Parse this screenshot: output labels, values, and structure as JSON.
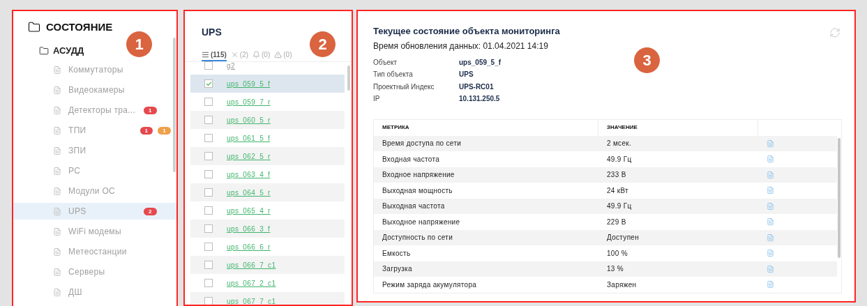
{
  "annotations": [
    {
      "label": "1"
    },
    {
      "label": "2"
    },
    {
      "label": "3"
    }
  ],
  "sidebar": {
    "tree": [
      {
        "label": "СОСТОЯНИЕ",
        "children": [
          {
            "label": "АСУДД",
            "children": [
              {
                "label": "Коммутаторы",
                "selected": false
              },
              {
                "label": "Видеокамеры",
                "selected": false
              },
              {
                "label": "Детекторы тра...",
                "selected": false,
                "badges": [
                  {
                    "text": "1",
                    "color": "#e5484d"
                  }
                ]
              },
              {
                "label": "ТПИ",
                "selected": false,
                "badges": [
                  {
                    "text": "1",
                    "color": "#e5484d"
                  },
                  {
                    "text": "1",
                    "color": "#f0a04b"
                  }
                ]
              },
              {
                "label": "ЗПИ",
                "selected": false
              },
              {
                "label": "РС",
                "selected": false
              },
              {
                "label": "Модули ОС",
                "selected": false
              },
              {
                "label": "UPS",
                "selected": true,
                "badges": [
                  {
                    "text": "2",
                    "color": "#e5484d"
                  }
                ]
              },
              {
                "label": "WiFi модемы",
                "selected": false
              },
              {
                "label": "Метеостанции",
                "selected": false
              },
              {
                "label": "Серверы",
                "selected": false
              },
              {
                "label": "ДШ",
                "selected": false
              }
            ]
          }
        ]
      }
    ]
  },
  "object_list": {
    "title": "UPS",
    "tabs": [
      {
        "kind": "all",
        "label": "(115)",
        "selected": true
      },
      {
        "kind": "error",
        "label": "(2)",
        "selected": false
      },
      {
        "kind": "alarm",
        "label": "(0)",
        "selected": false
      },
      {
        "kind": "warning",
        "label": "(0)",
        "selected": false
      }
    ],
    "rows": [
      {
        "kind": "group",
        "label": "g2",
        "checked": false,
        "selected": false
      },
      {
        "kind": "object",
        "label": "ups_059_5_f",
        "checked": true,
        "selected": true
      },
      {
        "kind": "object",
        "label": "ups_059_7_r",
        "checked": false,
        "selected": false
      },
      {
        "kind": "object",
        "label": "ups_060_5_r",
        "checked": false,
        "selected": false
      },
      {
        "kind": "object",
        "label": "ups_061_5_f",
        "checked": false,
        "selected": false
      },
      {
        "kind": "object",
        "label": "ups_062_5_r",
        "checked": false,
        "selected": false
      },
      {
        "kind": "object",
        "label": "ups_063_4_f",
        "checked": false,
        "selected": false
      },
      {
        "kind": "object",
        "label": "ups_064_5_r",
        "checked": false,
        "selected": false
      },
      {
        "kind": "object",
        "label": "ups_065_4_r",
        "checked": false,
        "selected": false
      },
      {
        "kind": "object",
        "label": "ups_066_3_f",
        "checked": false,
        "selected": false
      },
      {
        "kind": "object",
        "label": "ups_066_6_r",
        "checked": false,
        "selected": false
      },
      {
        "kind": "object",
        "label": "ups_066_7_c1",
        "checked": false,
        "selected": false
      },
      {
        "kind": "object",
        "label": "ups_067_2_c1",
        "checked": false,
        "selected": false
      },
      {
        "kind": "object",
        "label": "ups_067_7_c1",
        "checked": false,
        "selected": false
      }
    ]
  },
  "details": {
    "title": "Текущее состояние объекта мониторинга",
    "updated": "Время обновления данных: 01.04.2021 14:19",
    "fields": [
      {
        "label": "Объект",
        "value": "ups_059_5_f"
      },
      {
        "label": "Тип объекта",
        "value": "UPS"
      },
      {
        "label": "Проектный Индекс",
        "value": "UPS-RC01"
      },
      {
        "label": "IP",
        "value": "10.131.250.5"
      }
    ],
    "table": {
      "columns": [
        "МЕТРИКА",
        "ЗНАЧЕНИЕ"
      ],
      "rows": [
        [
          "Время доступа по сети",
          "2 мсек."
        ],
        [
          "Входная частота",
          "49.9 Гц"
        ],
        [
          "Входное напряжение",
          "233 В"
        ],
        [
          "Выходная мощность",
          "24 кВт"
        ],
        [
          "Выходная частота",
          "49.9 Гц"
        ],
        [
          "Выходное напряжение",
          "229 В"
        ],
        [
          "Доступность по сети",
          "Доступен"
        ],
        [
          "Емкость",
          "100 %"
        ],
        [
          "Загрузка",
          "13 %"
        ],
        [
          "Режим заряда акумулятора",
          "Заряжен"
        ]
      ]
    }
  }
}
